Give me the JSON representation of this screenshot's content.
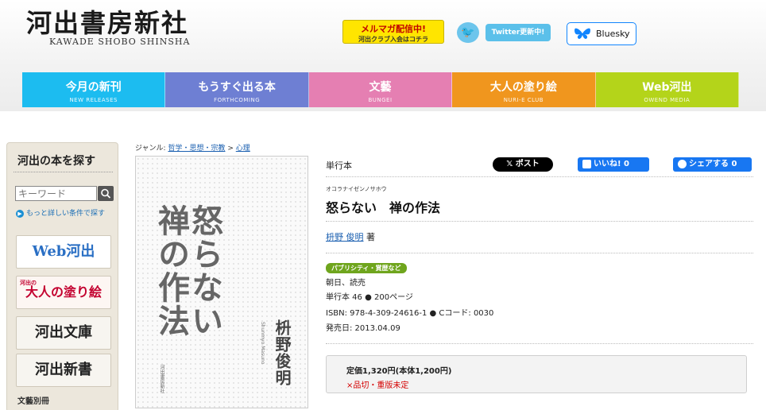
{
  "site": {
    "logo_jp": "河出書房新社",
    "logo_en": "KAWADE SHOBO SHINSHA"
  },
  "header_links": {
    "mailmag_line1": "メルマガ配信中!",
    "mailmag_line2": "河出クラブ入会はコチラ",
    "twitter_label": "Twitter更新中!",
    "bluesky_label": "Bluesky"
  },
  "nav": [
    {
      "jp": "今月の新刊",
      "en": "NEW RELEASES",
      "color": "#1cbcf0"
    },
    {
      "jp": "もうすぐ出る本",
      "en": "FORTHCOMING",
      "color": "#6e7fd3"
    },
    {
      "jp": "文藝",
      "en": "BUNGEI",
      "color": "#e57fb2"
    },
    {
      "jp": "大人の塗り絵",
      "en": "NURI-E CLUB",
      "color": "#f0961e"
    },
    {
      "jp": "Web河出",
      "en": "OWEND MEDIA",
      "color": "#b4d41a"
    }
  ],
  "sidebar": {
    "title": "河出の本を探す",
    "keyword_placeholder": "キーワード",
    "advanced_search": "もっと詳しい条件で探す",
    "banners": [
      "Web河出",
      "大人の塗り絵",
      "河出文庫",
      "河出新書"
    ],
    "banner_small_label": "河出の",
    "section_label": "文藝別冊"
  },
  "breadcrumb": {
    "prefix": "ジャンル: ",
    "genre": "哲学・思想・宗教",
    "separator": ">",
    "subgenre": "心理"
  },
  "cover": {
    "title_col1": "怒らない",
    "title_col2": "禅の作法",
    "author": "枡野俊明",
    "author_en": "Shunmyo Masuno",
    "publisher": "河出書房新社"
  },
  "book": {
    "format": "単行本",
    "ruby": "オコラナイゼンノサホウ",
    "title": "怒らない　禅の作法",
    "author_name": "枡野 俊明",
    "author_suffix": "著",
    "publicity_badge": "パブリシティ・賞歴など",
    "publicity": "朝日、読売",
    "spec": "単行本 46 ● 200ページ",
    "isbn": "ISBN: 978-4-309-24616-1 ● Cコード: 0030",
    "release": "発売日: 2013.04.09",
    "price": "定価1,320円(本体1,200円)",
    "stock": "×品切・重版未定"
  },
  "share": {
    "x_post": "ポスト",
    "fb_like": "いいね! 0",
    "fb_share": "シェアする 0"
  }
}
